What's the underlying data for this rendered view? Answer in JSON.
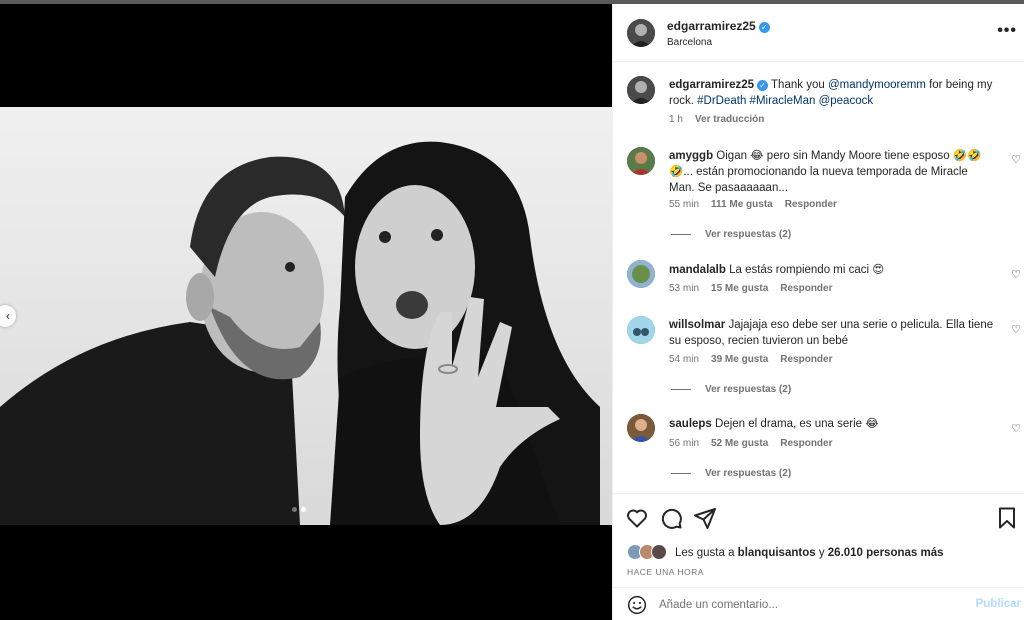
{
  "post": {
    "username": "edgarramirez25",
    "location": "Barcelona",
    "caption_mention": "@mandymooremm",
    "caption_text_1": "Thank you",
    "caption_text_2": "for being my",
    "caption_text_3": "rock.",
    "hashtag_1": "#DrDeath",
    "hashtag_2": "#MiracleMan",
    "caption_mention_2": "@peacock",
    "caption_time": "1 h",
    "translate_label": "Ver traducción",
    "more_label": "•••"
  },
  "carousel": {
    "prev_icon": "chevron-left-icon",
    "current": 2,
    "total": 2
  },
  "comments": [
    {
      "user": "amyggb",
      "text_a": "Oigan 😂 pero sin Mandy Moore tiene esposo 🤣🤣",
      "text_b": "🤣... están promocionando la nueva temporada de Miracle",
      "text_c": "Man. Se pasaaaaaan...",
      "time": "55 min",
      "likes": "111 Me gusta",
      "reply": "Responder",
      "view_replies": "Ver respuestas (2)"
    },
    {
      "user": "mandalalb",
      "text_a": "La estás rompiendo mi caci 😍",
      "time": "53 min",
      "likes": "15 Me gusta",
      "reply": "Responder"
    },
    {
      "user": "willsolmar",
      "text_a": "Jajajaja eso debe ser una serie o pelicula. Ella tiene",
      "text_b": "su esposo, recien tuvieron un bebé",
      "time": "54 min",
      "likes": "39 Me gusta",
      "reply": "Responder",
      "view_replies": "Ver respuestas (2)"
    },
    {
      "user": "sauleps",
      "text_a": "Dejen el drama, es una serie 😂",
      "time": "56 min",
      "likes": "52 Me gusta",
      "reply": "Responder",
      "view_replies": "Ver respuestas (2)"
    }
  ],
  "actions": {
    "like_icon": "heart-icon",
    "comment_icon": "comment-icon",
    "share_icon": "send-icon",
    "save_icon": "bookmark-icon",
    "likes_prefix": "Les gusta a",
    "likes_user": "blanquisantos",
    "likes_and": "y",
    "likes_count": "26.010 personas más",
    "timestamp": "HACE UNA HORA"
  },
  "add_comment": {
    "emoji_icon": "smiley-icon",
    "placeholder": "Añade un comentario...",
    "publish_label": "Publicar"
  },
  "colors": {
    "verified": "#3897f0",
    "link": "#00376b",
    "publish_disabled": "#b3dbff"
  }
}
